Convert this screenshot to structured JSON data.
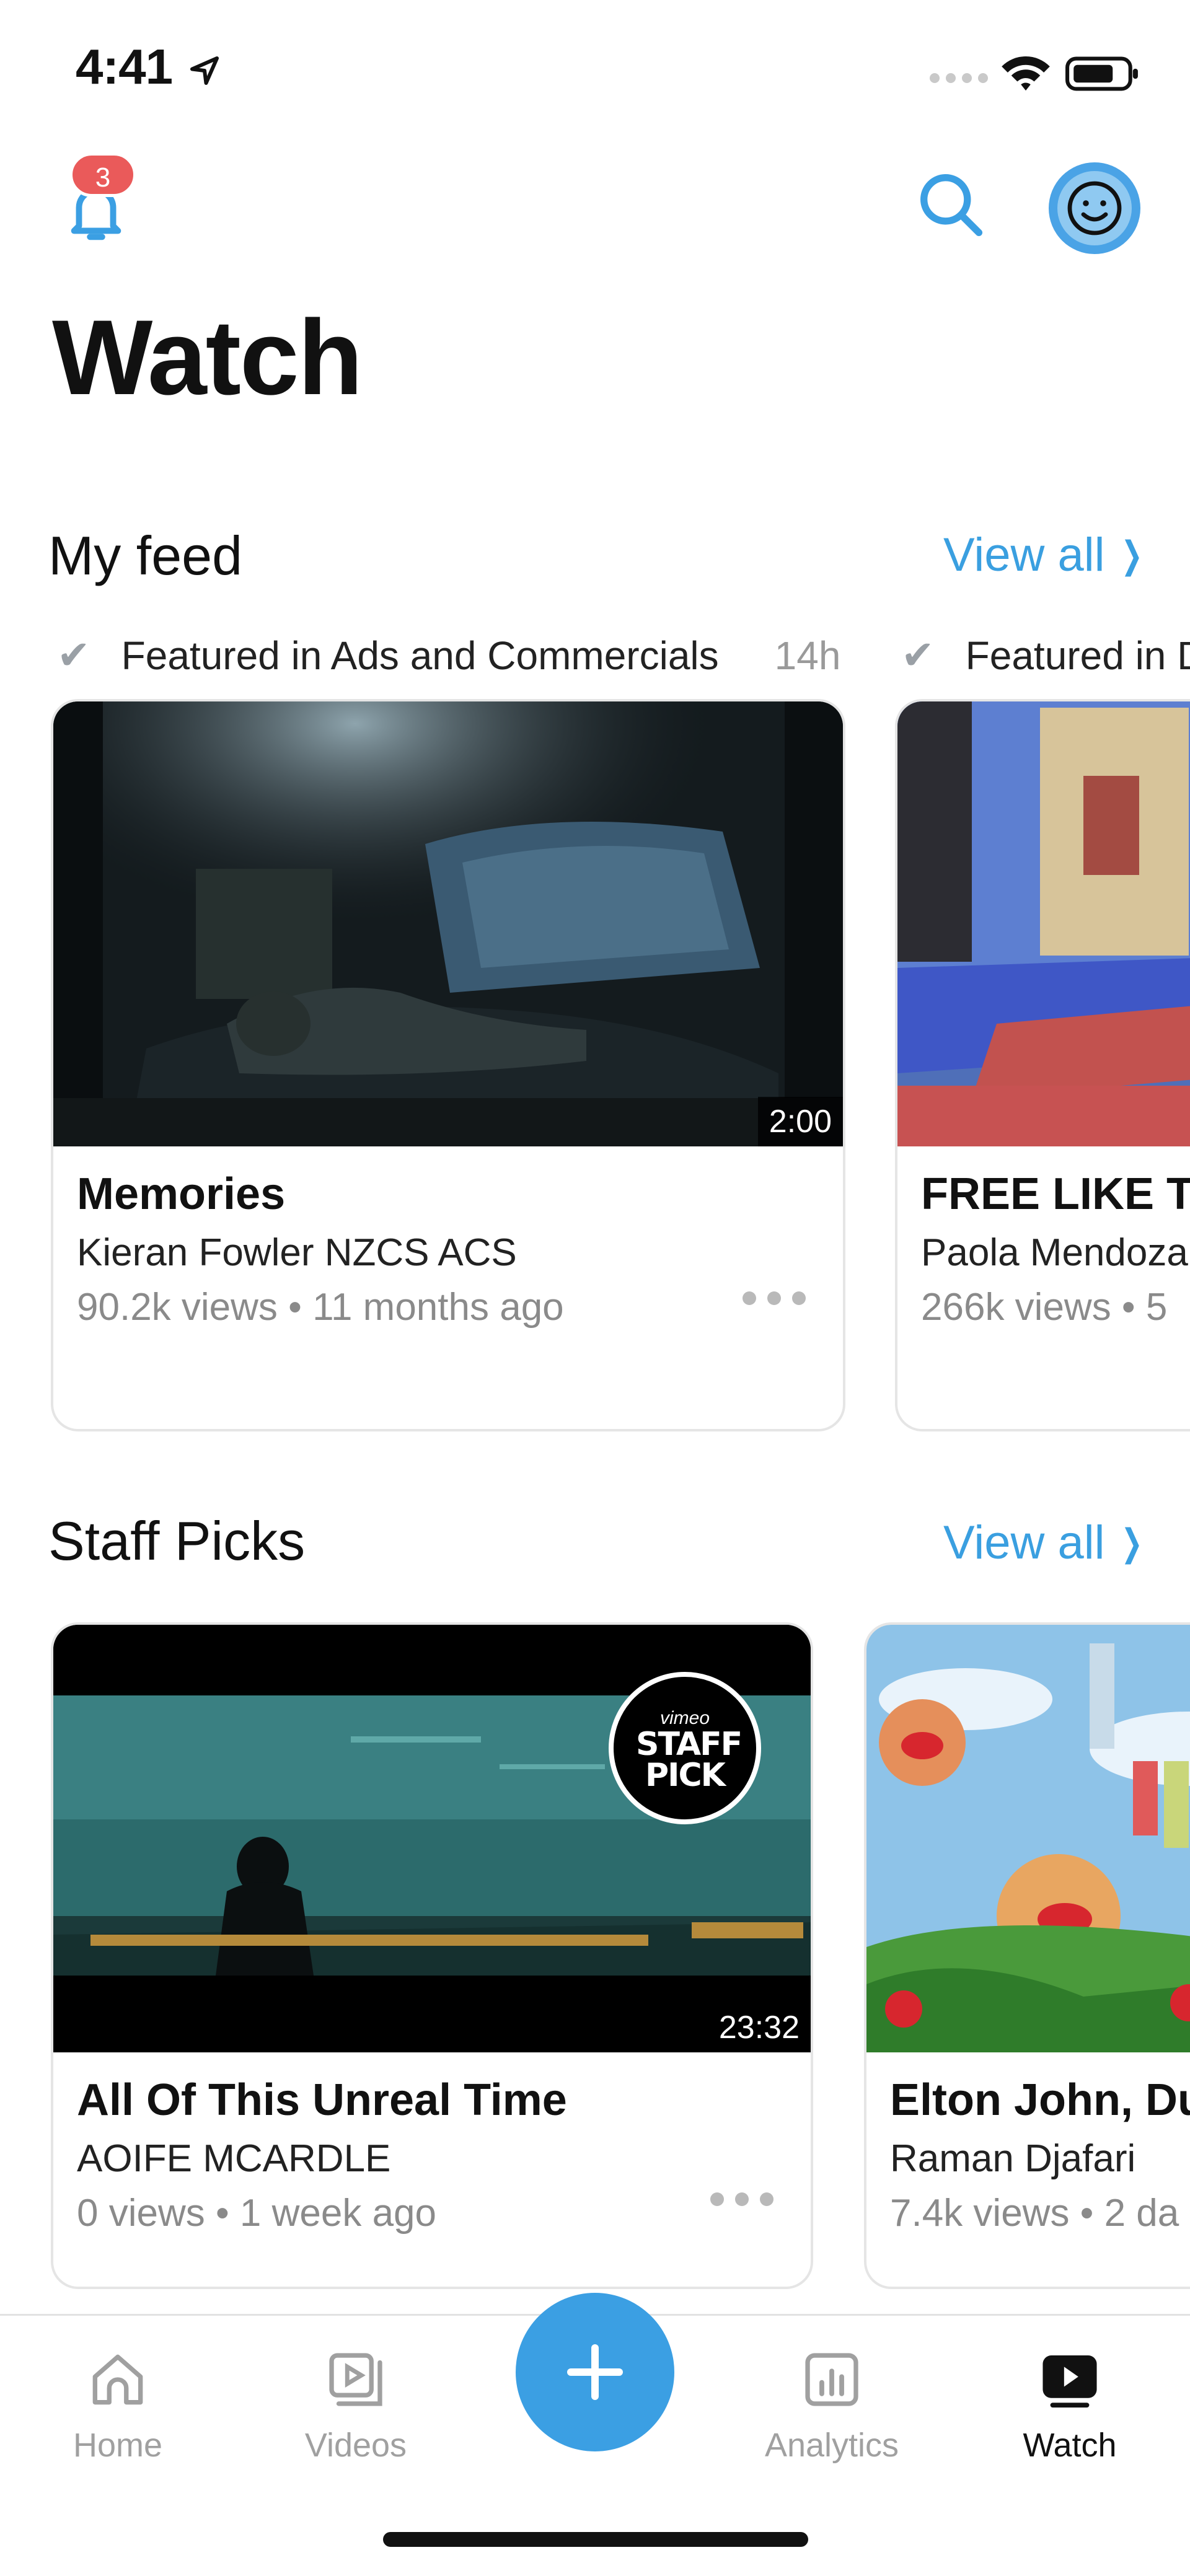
{
  "status_bar": {
    "time": "4:41"
  },
  "header": {
    "notification_count": "3",
    "title": "Watch"
  },
  "my_feed": {
    "title": "My feed",
    "view_all": "View all",
    "contexts": [
      {
        "label": "Featured in Ads and Commercials",
        "time": "14h"
      },
      {
        "label": "Featured in D"
      }
    ],
    "cards": [
      {
        "title": "Memories",
        "author": "Kieran Fowler NZCS ACS",
        "meta": "90.2k views • 11 months ago",
        "duration": "2:00"
      },
      {
        "title": "FREE LIKE TI",
        "author": "Paola Mendoza",
        "meta": "266k views • 5"
      }
    ]
  },
  "staff_picks": {
    "title": "Staff Picks",
    "view_all": "View all",
    "badge_top": "vimeo",
    "badge_main": "STAFF PICK",
    "cards": [
      {
        "title": "All Of This Unreal Time",
        "author": "AOIFE MCARDLE",
        "meta": "0 views • 1 week ago",
        "duration": "23:32"
      },
      {
        "title": "Elton John, Du",
        "author": "Raman Djafari",
        "meta": "7.4k views • 2 da"
      }
    ]
  },
  "tabbar": {
    "items": [
      {
        "label": "Home",
        "icon": "home-icon"
      },
      {
        "label": "Videos",
        "icon": "videos-icon"
      },
      {
        "label": "Analytics",
        "icon": "analytics-icon"
      },
      {
        "label": "Watch",
        "icon": "watch-icon",
        "active": true
      }
    ],
    "fab_icon": "plus-icon"
  },
  "colors": {
    "accent": "#3b9fe3",
    "badge": "#ea5a5a"
  }
}
